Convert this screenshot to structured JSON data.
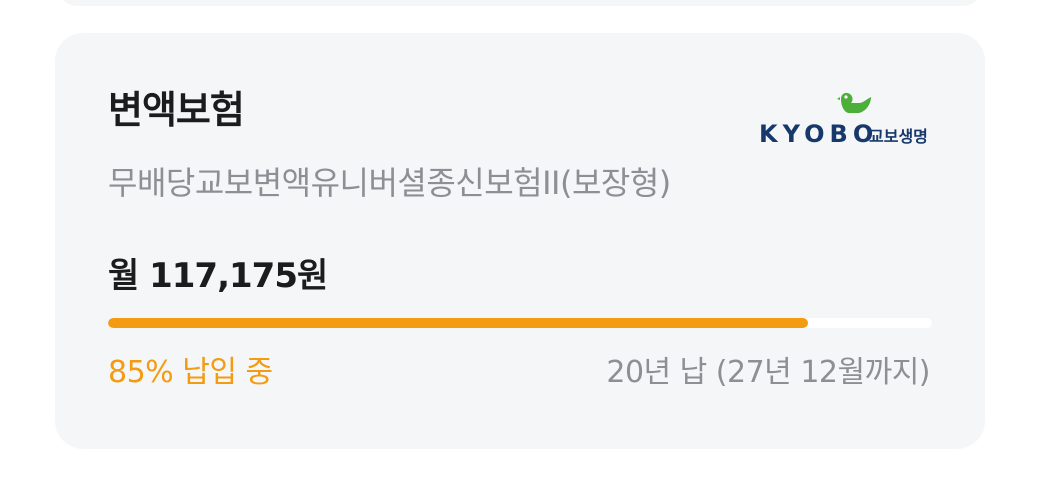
{
  "insurance_card": {
    "title": "변액보험",
    "product_name": "무배당교보변액유니버셜종신보험II(보장형)",
    "monthly_amount": "월 117,175원",
    "progress_percent": 85,
    "status_text": "85% 납입 중",
    "period_text": "20년 납 (27년 12월까지)",
    "company_logo": {
      "latin": "KYOBO",
      "korean": "교보생명",
      "icon": "kyobo-bird-icon"
    }
  },
  "colors": {
    "accent": "#f39c12",
    "card_bg": "#f5f6f8",
    "title_text": "#1b1c1e",
    "secondary_text": "#8c8f94",
    "logo_navy": "#16386b",
    "logo_green": "#4caf3a"
  }
}
